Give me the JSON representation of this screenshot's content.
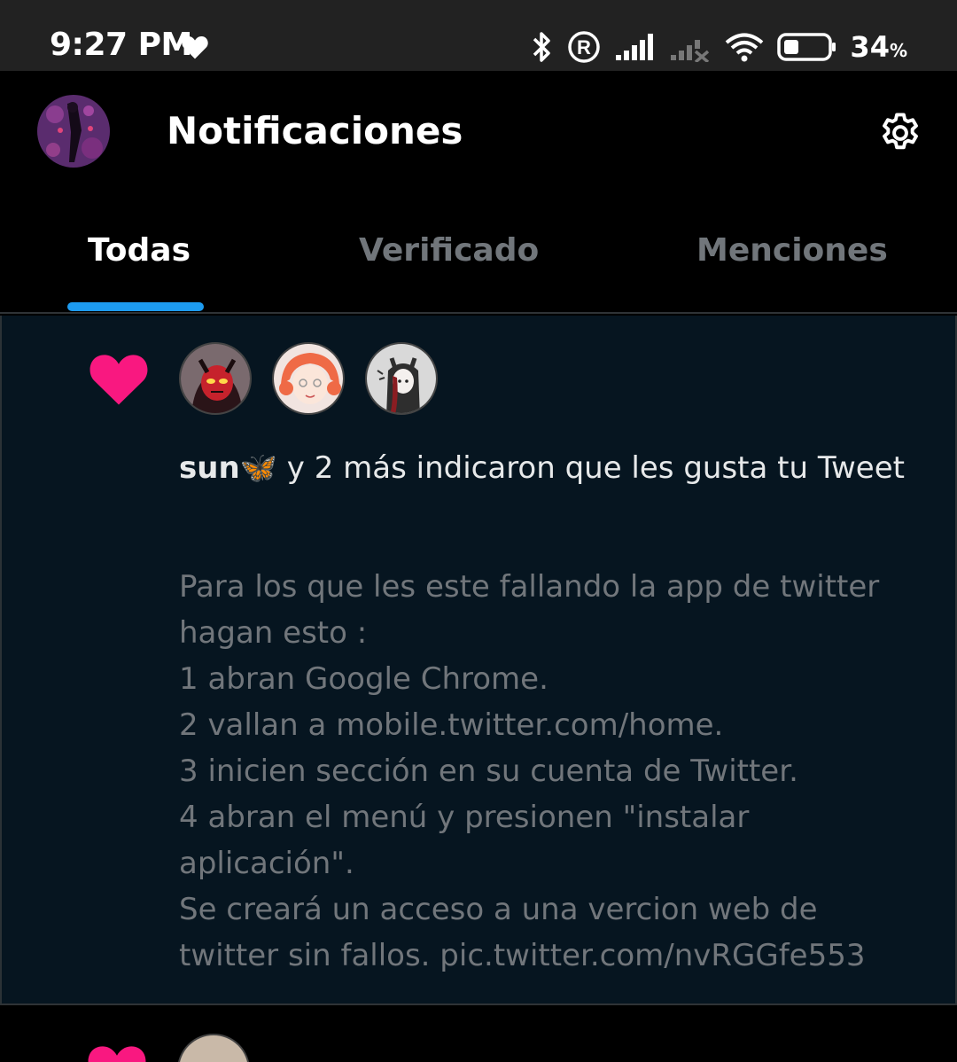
{
  "status_bar": {
    "time": "9:27 PM",
    "battery_percent": "34",
    "battery_unit": "%",
    "icons": [
      "heart-icon",
      "bluetooth-icon",
      "registered-icon",
      "signal-icon",
      "signal-no-service-icon",
      "wifi-icon",
      "battery-icon"
    ]
  },
  "header": {
    "title": "Notificaciones",
    "avatar": "profile-avatar",
    "settings_icon": "gear-icon"
  },
  "tabs": [
    {
      "label": "Todas",
      "active": true
    },
    {
      "label": "Verificado",
      "active": false
    },
    {
      "label": "Menciones",
      "active": false
    }
  ],
  "notifications": [
    {
      "type_icon": "heart-icon",
      "avatars": [
        "avatar-user-1",
        "avatar-user-2",
        "avatar-user-3"
      ],
      "actor": "sun🦋",
      "action": " y 2 más indicaron que les gusta tu Tweet",
      "text": "Para los que les este fallando la app de twitter hagan esto :\n1 abran Google Chrome.\n2 vallan a mobile.twitter.com/home.\n3 inicien sección en su cuenta de Twitter.\n4 abran el menú y presionen \"instalar aplicación\".\nSe creará un acceso a una vercion web de twitter sin fallos. pic.twitter.com/nvRGGfe553"
    }
  ],
  "colors": {
    "accent": "#1d9bf0",
    "like": "#f91880",
    "muted_text": "#71767b",
    "unread_bg": "#061520"
  }
}
